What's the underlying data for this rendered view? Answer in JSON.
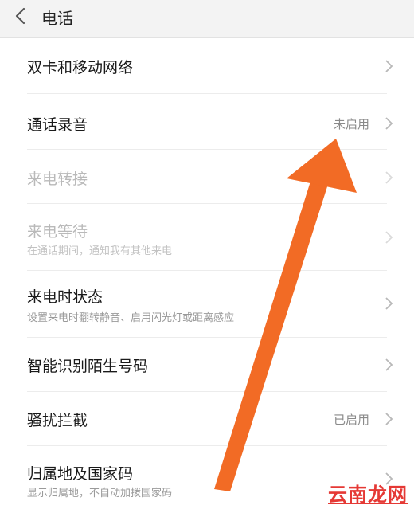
{
  "header": {
    "title": "电话"
  },
  "rows": [
    {
      "label": "双卡和移动网络",
      "sub": "",
      "value": "",
      "disabled": false
    },
    {
      "label": "通话录音",
      "sub": "",
      "value": "未启用",
      "disabled": false
    },
    {
      "label": "来电转接",
      "sub": "",
      "value": "",
      "disabled": true
    },
    {
      "label": "来电等待",
      "sub": "在通话期间，通知我有其他来电",
      "value": "",
      "disabled": true
    },
    {
      "label": "来电时状态",
      "sub": "设置来电时翻转静音、启用闪光灯或距离感应",
      "value": "",
      "disabled": false
    },
    {
      "label": "智能识别陌生号码",
      "sub": "",
      "value": "",
      "disabled": false
    },
    {
      "label": "骚扰拦截",
      "sub": "",
      "value": "已启用",
      "disabled": false
    },
    {
      "label": "归属地及国家码",
      "sub": "显示归属地，不自动加拨国家码",
      "value": "",
      "disabled": false
    }
  ],
  "watermark": {
    "text": "云南龙网"
  },
  "colors": {
    "arrow": "#f26b25",
    "header_bg": "#f3f3f3",
    "watermark": "#e53935"
  },
  "icons": {
    "back": "chevron-left-icon",
    "row_chevron": "chevron-right-icon",
    "overlay": "orange-arrow-annotation"
  }
}
